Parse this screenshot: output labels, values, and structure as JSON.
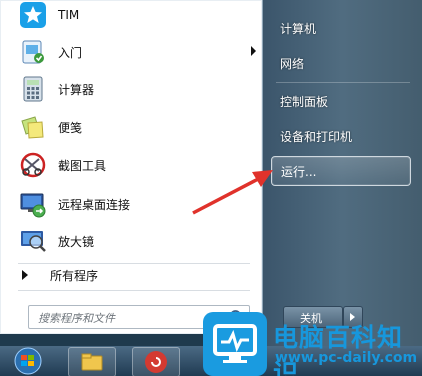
{
  "programs": [
    {
      "label": "TIM",
      "icon": "tim-icon",
      "has_submenu": false
    },
    {
      "label": "入门",
      "icon": "getting-started-icon",
      "has_submenu": true
    },
    {
      "label": "计算器",
      "icon": "calculator-icon",
      "has_submenu": false
    },
    {
      "label": "便笺",
      "icon": "sticky-notes-icon",
      "has_submenu": false
    },
    {
      "label": "截图工具",
      "icon": "snipping-tool-icon",
      "has_submenu": false
    },
    {
      "label": "远程桌面连接",
      "icon": "remote-desktop-icon",
      "has_submenu": false
    },
    {
      "label": "放大镜",
      "icon": "magnifier-icon",
      "has_submenu": false
    }
  ],
  "all_programs_label": "所有程序",
  "search": {
    "placeholder": "搜索程序和文件"
  },
  "right_items": [
    {
      "label": "计算机"
    },
    {
      "label": "网络"
    },
    {
      "label": "控制面板"
    },
    {
      "label": "设备和打印机"
    },
    {
      "label": "运行..."
    }
  ],
  "shutdown_label": "关机",
  "watermark": {
    "title": "电脑百科知识",
    "url": "www.pc-daily.com"
  },
  "colors": {
    "accent": "#1797dc",
    "arrow": "#e0322b",
    "start_panel": "#ffffff"
  }
}
